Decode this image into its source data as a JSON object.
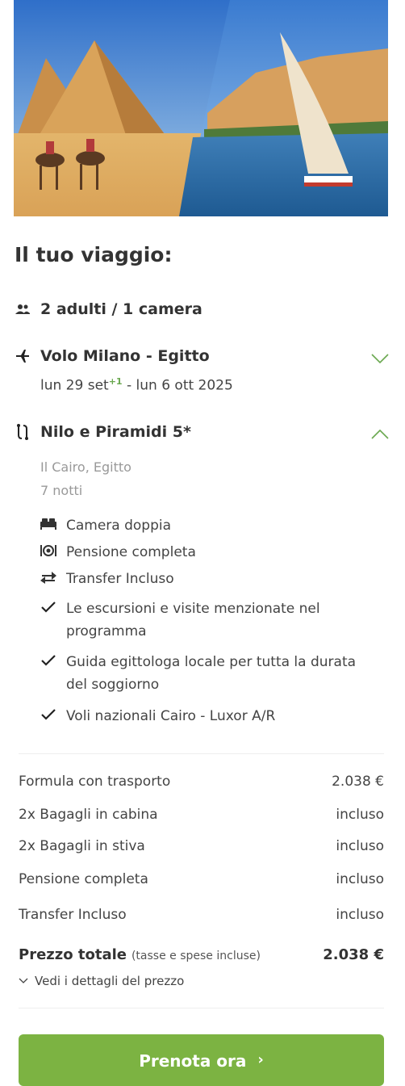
{
  "hero": {
    "alt_icon": "egypt-hero-image"
  },
  "trip": {
    "title": "Il tuo viaggio:",
    "guests": "2 adulti / 1 camera",
    "flight": {
      "title": "Volo Milano - Egitto",
      "date_out": "lun 29 set",
      "plus_day": "+1",
      "date_return": "- lun 6 ott 2025"
    },
    "hotel": {
      "title": "Nilo e Piramidi 5*",
      "location": "Il Cairo, Egitto",
      "nights": "7 notti",
      "features": [
        {
          "icon": "bed-icon",
          "text": "Camera doppia"
        },
        {
          "icon": "dining-icon",
          "text": "Pensione completa"
        },
        {
          "icon": "transfer-icon",
          "text": "Transfer Incluso"
        },
        {
          "icon": "check-icon",
          "text": "Le escursioni e visite menzionate nel programma"
        },
        {
          "icon": "check-icon",
          "text": "Guida egittologa locale per tutta la durata del soggiorno"
        },
        {
          "icon": "check-icon",
          "text": "Voli nazionali Cairo - Luxor A/R"
        }
      ]
    }
  },
  "prices": {
    "rows": [
      {
        "label": "Formula con trasporto",
        "value": "2.038 €"
      },
      {
        "label": "2x Bagagli in cabina",
        "value": "incluso"
      },
      {
        "label": "2x Bagagli in stiva",
        "value": "incluso"
      },
      {
        "label": "Pensione completa",
        "value": "incluso"
      },
      {
        "label": "Transfer Incluso",
        "value": "incluso"
      }
    ],
    "total_label": "Prezzo totale",
    "total_note": "(tasse e spese incluse)",
    "total_value": "2.038 €",
    "details_link": "Vedi i dettagli del prezzo"
  },
  "cta": {
    "label": "Prenota ora",
    "arrow": "›"
  },
  "colors": {
    "accent": "#7cb342",
    "chevron": "#6aa84f"
  }
}
